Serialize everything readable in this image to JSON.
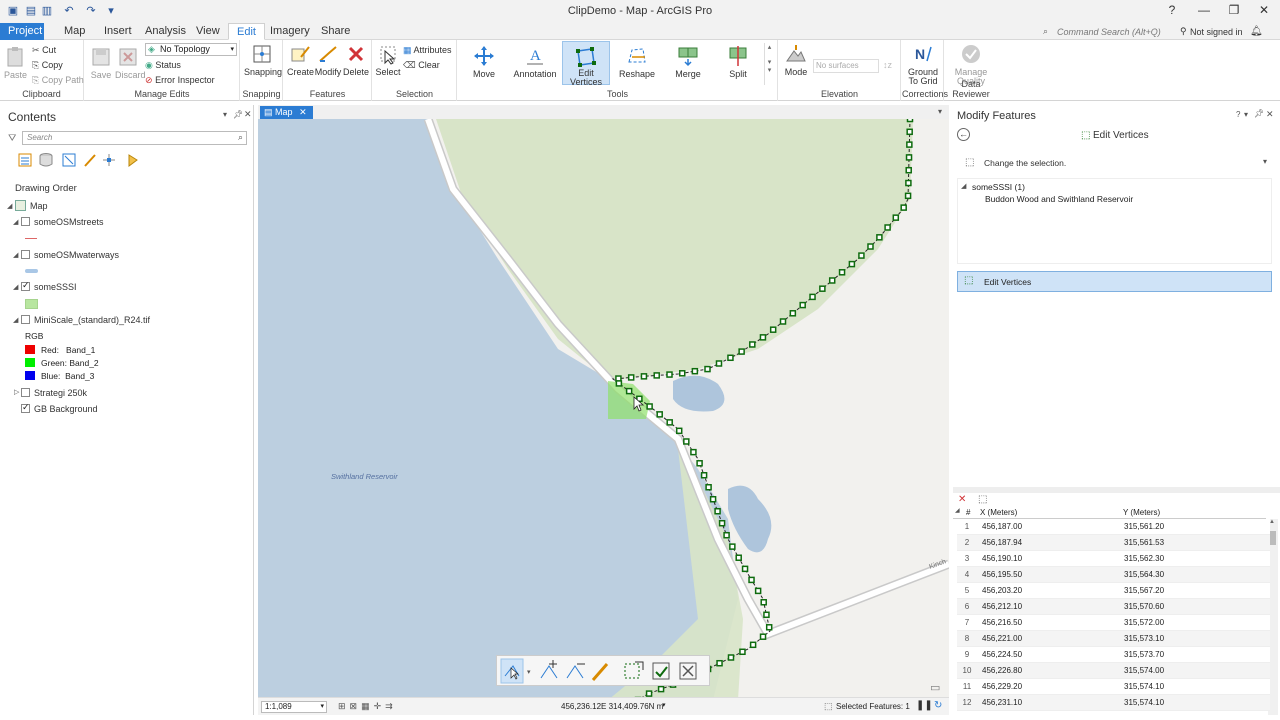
{
  "window": {
    "title": "ClipDemo - Map - ArcGIS Pro",
    "help": "?",
    "minimize": "—",
    "restore": "❐",
    "close": "✕"
  },
  "search": {
    "placeholder": "Command Search (Alt+Q)"
  },
  "user": {
    "signin": "Not signed in"
  },
  "tabs": [
    {
      "label": "Project"
    },
    {
      "label": "Map"
    },
    {
      "label": "Insert"
    },
    {
      "label": "Analysis"
    },
    {
      "label": "View"
    },
    {
      "label": "Edit"
    },
    {
      "label": "Imagery"
    },
    {
      "label": "Share"
    }
  ],
  "ribbon": {
    "clipboard": {
      "label": "Clipboard",
      "paste": "Paste",
      "cut": "Cut",
      "copy": "Copy",
      "copy_path": "Copy Path"
    },
    "manage_edits": {
      "label": "Manage Edits",
      "save": "Save",
      "discard": "Discard",
      "topology": "No Topology",
      "status": "Status",
      "error_inspector": "Error Inspector"
    },
    "snapping": {
      "label": "Snapping",
      "btn": "Snapping"
    },
    "features": {
      "label": "Features",
      "create": "Create",
      "modify": "Modify",
      "delete": "Delete"
    },
    "selection": {
      "label": "Selection",
      "select": "Select",
      "attributes": "Attributes",
      "clear": "Clear"
    },
    "tools": {
      "label": "Tools",
      "move": "Move",
      "annotation": "Annotation",
      "edit_vertices_1": "Edit",
      "edit_vertices_2": "Vertices",
      "reshape": "Reshape",
      "merge": "Merge",
      "split": "Split"
    },
    "elevation": {
      "label": "Elevation",
      "mode": "Mode",
      "surfaces": "No surfaces"
    },
    "corrections": {
      "label": "Corrections",
      "ground_1": "Ground",
      "ground_2": "To Grid"
    },
    "data_reviewer": {
      "label": "Data Reviewer",
      "manage_1": "Manage",
      "manage_2": "Quality"
    }
  },
  "contents": {
    "title": "Contents",
    "search_placeholder": "Search",
    "drawing_order": "Drawing Order",
    "layers": [
      {
        "name": "Map",
        "checked": true
      },
      {
        "name": "someOSMstreets",
        "checked": false
      },
      {
        "name": "someOSMwaterways",
        "checked": false
      },
      {
        "name": "someSSSI",
        "checked": true
      },
      {
        "name": "MiniScale_(standard)_R24.tif",
        "checked": false
      },
      {
        "name": "RGB"
      },
      {
        "name": "Red:   Band_1"
      },
      {
        "name": "Green: Band_2"
      },
      {
        "name": "Blue:  Band_3"
      },
      {
        "name": "Strategi 250k",
        "checked": false
      },
      {
        "name": "GB Background",
        "checked": true
      }
    ]
  },
  "map": {
    "tab": "Map",
    "label_reservoir": "Swithland Reservoir",
    "label_road": "Kinch",
    "scale": "1:1,089",
    "coords": "456,236.12E 314,409.76N m",
    "selected": "Selected Features: 1"
  },
  "modify": {
    "title": "Modify Features",
    "tool_title": "Edit Vertices",
    "change_selection": "Change the selection.",
    "layer": "someSSSI (1)",
    "feature": "Buddon Wood and Swithland Reservoir",
    "tool_item": "Edit Vertices",
    "col_hash": "#",
    "col_x": "X (Meters)",
    "col_y": "Y (Meters)",
    "rows": [
      {
        "n": "1",
        "x": "456,187.00",
        "y": "315,561.20"
      },
      {
        "n": "2",
        "x": "456,187.94",
        "y": "315,561.53"
      },
      {
        "n": "3",
        "x": "456,190.10",
        "y": "315,562.30"
      },
      {
        "n": "4",
        "x": "456,195.50",
        "y": "315,564.30"
      },
      {
        "n": "5",
        "x": "456,203.20",
        "y": "315,567.20"
      },
      {
        "n": "6",
        "x": "456,212.10",
        "y": "315,570.60"
      },
      {
        "n": "7",
        "x": "456,216.50",
        "y": "315,572.00"
      },
      {
        "n": "8",
        "x": "456,221.00",
        "y": "315,573.10"
      },
      {
        "n": "9",
        "x": "456,224.50",
        "y": "315,573.70"
      },
      {
        "n": "10",
        "x": "456,226.80",
        "y": "315,574.00"
      },
      {
        "n": "11",
        "x": "456,229.20",
        "y": "315,574.10"
      },
      {
        "n": "12",
        "x": "456,231.10",
        "y": "315,574.10"
      }
    ]
  },
  "colors": {
    "accent": "#2b7cd3",
    "sssi": "#b8e6a0",
    "water": "#bccfe0",
    "wood": "#d8e4c8",
    "vertex": "#0e6b0e"
  }
}
